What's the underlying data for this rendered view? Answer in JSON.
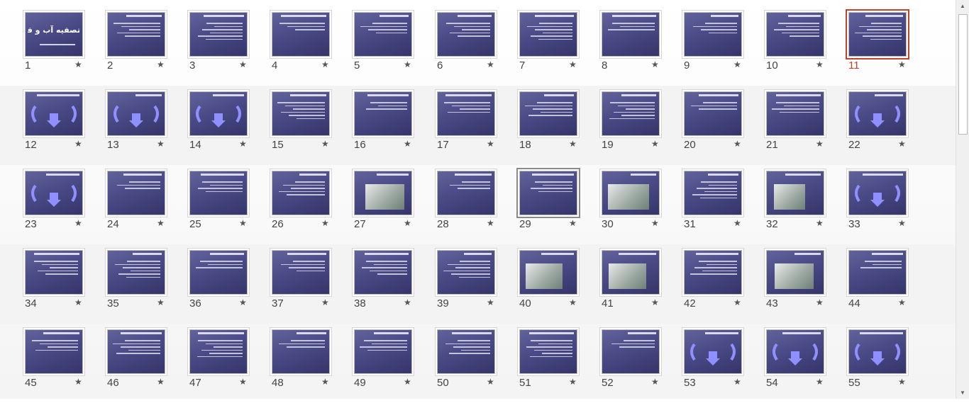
{
  "star_glyph": "★",
  "selected_slide": "11",
  "scrollbar": {
    "up_glyph": "▲",
    "down_glyph": "▼"
  },
  "rows": [
    {
      "slides": [
        {
          "number": "1",
          "kind": "title"
        },
        {
          "number": "2",
          "kind": "bullets"
        },
        {
          "number": "3",
          "kind": "bullets"
        },
        {
          "number": "4",
          "kind": "bullets"
        },
        {
          "number": "5",
          "kind": "bullets"
        },
        {
          "number": "6",
          "kind": "bullets"
        },
        {
          "number": "7",
          "kind": "bullets"
        },
        {
          "number": "8",
          "kind": "bullets"
        },
        {
          "number": "9",
          "kind": "bullets"
        },
        {
          "number": "10",
          "kind": "bullets"
        },
        {
          "number": "11",
          "kind": "bullets"
        }
      ]
    },
    {
      "slides": [
        {
          "number": "12",
          "kind": "diagram"
        },
        {
          "number": "13",
          "kind": "diagram"
        },
        {
          "number": "14",
          "kind": "diagram"
        },
        {
          "number": "15",
          "kind": "bullets"
        },
        {
          "number": "16",
          "kind": "bullets"
        },
        {
          "number": "17",
          "kind": "bullets"
        },
        {
          "number": "18",
          "kind": "bullets"
        },
        {
          "number": "19",
          "kind": "bullets"
        },
        {
          "number": "20",
          "kind": "bullets"
        },
        {
          "number": "21",
          "kind": "bullets"
        },
        {
          "number": "22",
          "kind": "diagram"
        }
      ]
    },
    {
      "slides": [
        {
          "number": "23",
          "kind": "diagram"
        },
        {
          "number": "24",
          "kind": "bullets"
        },
        {
          "number": "25",
          "kind": "bullets"
        },
        {
          "number": "26",
          "kind": "bullets"
        },
        {
          "number": "27",
          "kind": "photo"
        },
        {
          "number": "28",
          "kind": "bullets"
        },
        {
          "number": "29",
          "kind": "bullets"
        },
        {
          "number": "30",
          "kind": "photo"
        },
        {
          "number": "31",
          "kind": "bullets"
        },
        {
          "number": "32",
          "kind": "photo"
        },
        {
          "number": "33",
          "kind": "diagram"
        }
      ]
    },
    {
      "slides": [
        {
          "number": "34",
          "kind": "bullets"
        },
        {
          "number": "35",
          "kind": "bullets"
        },
        {
          "number": "36",
          "kind": "bullets"
        },
        {
          "number": "37",
          "kind": "bullets"
        },
        {
          "number": "38",
          "kind": "bullets"
        },
        {
          "number": "39",
          "kind": "bullets"
        },
        {
          "number": "40",
          "kind": "photo"
        },
        {
          "number": "41",
          "kind": "photo"
        },
        {
          "number": "42",
          "kind": "bullets"
        },
        {
          "number": "43",
          "kind": "photo"
        },
        {
          "number": "44",
          "kind": "bullets"
        }
      ]
    },
    {
      "slides": [
        {
          "number": "45",
          "kind": "bullets"
        },
        {
          "number": "46",
          "kind": "bullets"
        },
        {
          "number": "47",
          "kind": "bullets"
        },
        {
          "number": "48",
          "kind": "bullets"
        },
        {
          "number": "49",
          "kind": "bullets"
        },
        {
          "number": "50",
          "kind": "bullets"
        },
        {
          "number": "51",
          "kind": "bullets"
        },
        {
          "number": "52",
          "kind": "bullets"
        },
        {
          "number": "53",
          "kind": "diagram"
        },
        {
          "number": "54",
          "kind": "diagram"
        },
        {
          "number": "55",
          "kind": "diagram"
        }
      ]
    }
  ],
  "slide_1": {
    "title": "تصفیه آب و فاضلاب"
  },
  "colors": {
    "slide_bg": "#4a4a86",
    "selection": "#c0432b",
    "secondary_selection": "#8a8a8a",
    "arrow": "#8f8fff"
  }
}
